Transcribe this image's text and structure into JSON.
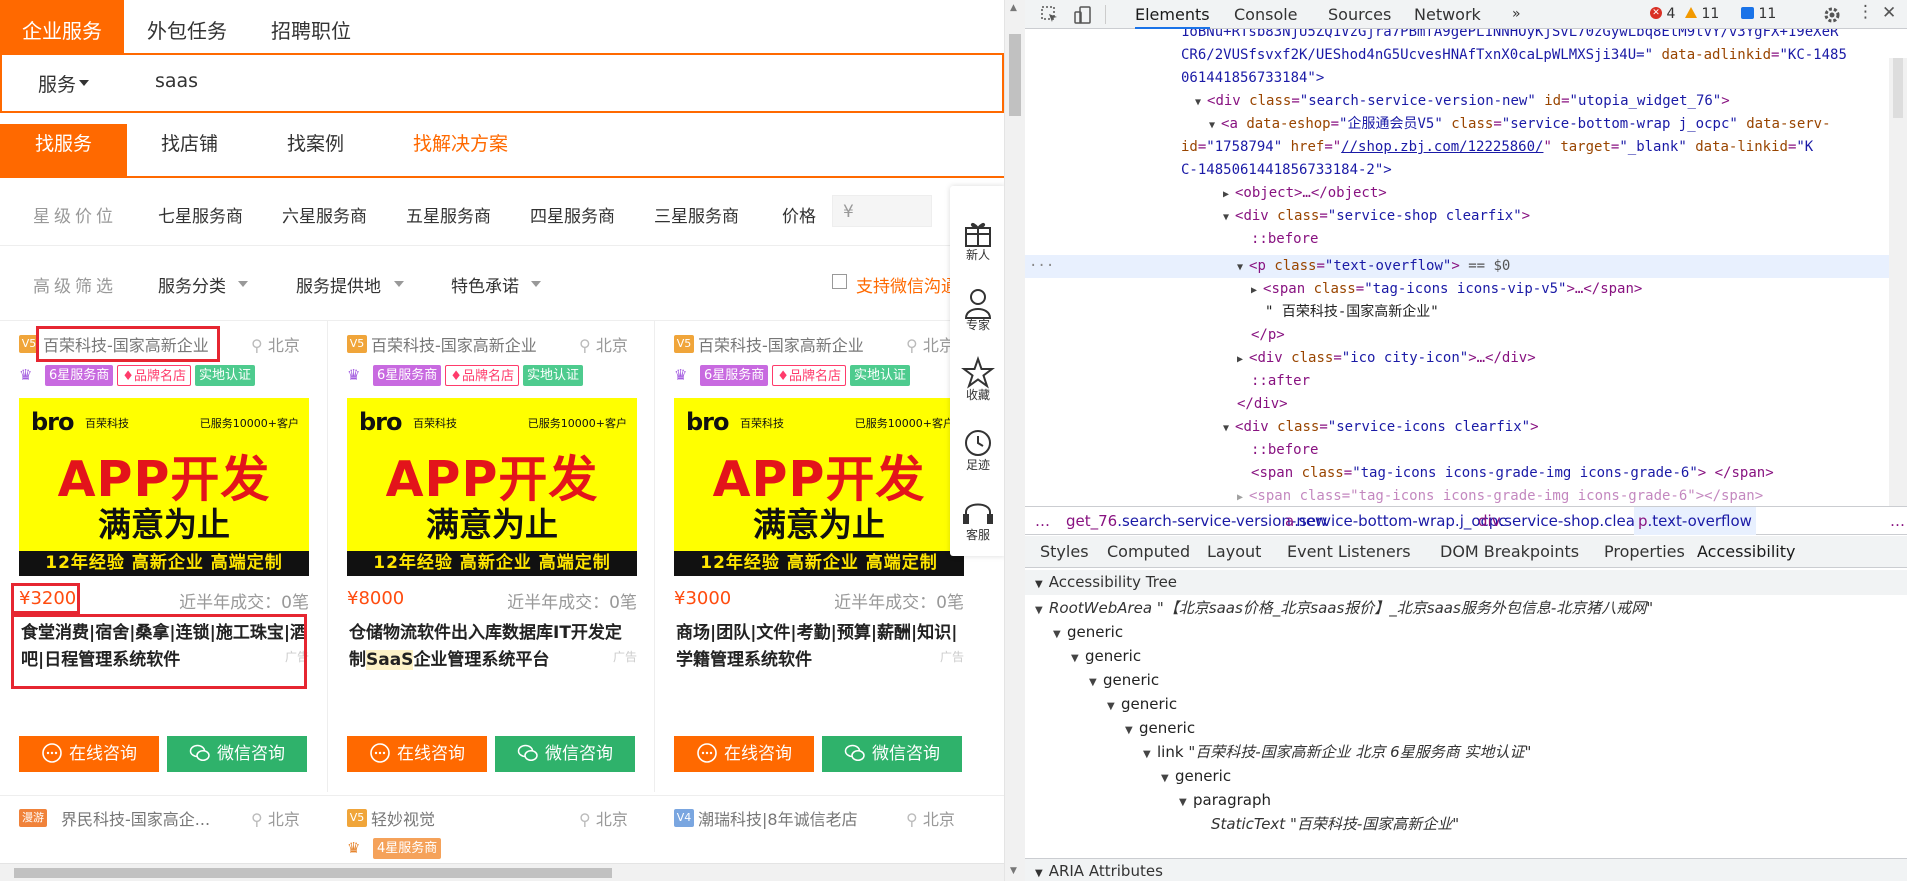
{
  "site": {
    "top_tabs": [
      "企业服务",
      "外包任务",
      "招聘职位"
    ],
    "search": {
      "category": "服务",
      "query": "saas"
    },
    "sub_tabs": [
      "找服务",
      "找店铺",
      "找案例",
      "找解决方案"
    ],
    "star_filter": {
      "label": "星级价位",
      "options": [
        "七星服务商",
        "六星服务商",
        "五星服务商",
        "四星服务商",
        "三星服务商"
      ],
      "price_label": "价格",
      "price_placeholder": "¥"
    },
    "adv_filter": {
      "label": "高级筛选",
      "dropdowns": [
        "服务分类",
        "服务提供地",
        "特色承诺"
      ],
      "checkbox_label": "支持微信沟通"
    },
    "side_float": [
      "新人",
      "专家",
      "收藏",
      "足迹",
      "客服"
    ],
    "cards": [
      {
        "badge": "V5",
        "shop": "百荣科技-国家高新企业",
        "city": "北京",
        "tags": [
          "6星服务商",
          "品牌名店",
          "实地认证"
        ],
        "banner": {
          "brand": "bro",
          "brand_cn": "百荣科技",
          "served": "已服务10000+客户",
          "headline": "APP开发",
          "sub": "满意为止",
          "strip": "12年经验 高新企业 高端定制"
        },
        "price": "¥3200",
        "sold": "近半年成交：0笔",
        "title_parts": [
          "食堂消费|宿舍|桑拿|连锁|施工珠宝|酒吧|日程管理系统软件"
        ],
        "ad": "广告",
        "btn_online": "在线咨询",
        "btn_wx": "微信咨询"
      },
      {
        "badge": "V5",
        "shop": "百荣科技-国家高新企业",
        "city": "北京",
        "tags": [
          "6星服务商",
          "品牌名店",
          "实地认证"
        ],
        "banner": {
          "brand": "bro",
          "brand_cn": "百荣科技",
          "served": "已服务10000+客户",
          "headline": "APP开发",
          "sub": "满意为止",
          "strip": "12年经验 高新企业 高端定制"
        },
        "price": "¥8000",
        "sold": "近半年成交：0笔",
        "title_a": "仓储物流软件出入库数据库IT开发定制",
        "title_hl": "SaaS",
        "title_b": "企业管理系统平台",
        "ad": "广告",
        "btn_online": "在线咨询",
        "btn_wx": "微信咨询"
      },
      {
        "badge": "V5",
        "shop": "百荣科技-国家高新企业",
        "city": "北京",
        "tags": [
          "6星服务商",
          "品牌名店",
          "实地认证"
        ],
        "banner": {
          "brand": "bro",
          "brand_cn": "百荣科技",
          "served": "已服务10000+客户",
          "headline": "APP开发",
          "sub": "满意为止",
          "strip": "12年经验 高新企业 高端定制"
        },
        "price": "¥3000",
        "sold": "近半年成交：0笔",
        "title": "商场|团队|文件|考勤|预算|薪酬|知识|学籍管理系统软件",
        "ad": "广告",
        "btn_online": "在线咨询",
        "btn_wx": "微信咨询"
      }
    ],
    "next_cards": [
      {
        "badge": "漫游",
        "shop": "界民科技-国家高企...",
        "city": "北京"
      },
      {
        "badge": "V5",
        "shop": "轻妙视觉",
        "city": "北京",
        "tag": "4星服务商"
      },
      {
        "badge": "V4",
        "shop": "潮瑞科技|8年诚信老店",
        "city": "北京"
      }
    ]
  },
  "devtools": {
    "tabs": [
      "Elements",
      "Console",
      "Sources",
      "Network"
    ],
    "errors": "4",
    "warnings": "11",
    "messages": "11",
    "dom_lines": [
      {
        "text": "1oBNu+RTsb83NjU5ZQ1VzGjra7PBmfA9gePL1NNHOyKjSvL70zGywLbq8EtM9tvY/v3YgFX+19eXeR"
      },
      {
        "text_a": "CR6/2VUSfsvxf2K/UEShod4nG5UcvesHNAfTxnX0caLpWLMXSji34U=\"",
        "attr": "data-adlinkid",
        "val": "\"KC-1485"
      },
      {
        "text": "061441856733184\">"
      },
      {
        "tag": "div",
        "attr1": "class",
        "val1": "\"search-service-version-new\"",
        "attr2": "id",
        "val2": "\"utopia_widget_76\""
      },
      {
        "tag": "a",
        "attr1": "data-eshop",
        "val1": "\"企服通会员V5\"",
        "attr2": "class",
        "val2": "\"service-bottom-wrap j_ocpc\"",
        "attr3": "data-serv-"
      },
      {
        "text_a": "id",
        "val": "\"1758794\"",
        "attr2": "href",
        "link": "//shop.zbj.com/12225860/",
        "attr3": "target",
        "val3": "\"_blank\"",
        "attr4": "data-linkid",
        "val4": "\"K"
      },
      {
        "text": "C-1485061441856733184-2\">"
      },
      {
        "text": "<object>…</object>"
      },
      {
        "tag": "div",
        "attr1": "class",
        "val1": "\"service-shop clearfix\""
      },
      {
        "text": "::before"
      },
      {
        "tag": "p",
        "attr1": "class",
        "val1": "\"text-overflow\"",
        "eq": "== $0"
      },
      {
        "tag": "span",
        "attr1": "class",
        "val1": "\"tag-icons icons-vip-v5\""
      },
      {
        "text": "\" 百荣科技-国家高新企业\""
      },
      {
        "text": "</p>"
      },
      {
        "tag": "div",
        "attr1": "class",
        "val1": "\"ico city-icon\""
      },
      {
        "text": "::after"
      },
      {
        "text": "</div>"
      },
      {
        "tag": "div",
        "attr1": "class",
        "val1": "\"service-icons clearfix\""
      },
      {
        "text": "::before"
      },
      {
        "tag": "span",
        "attr1": "class",
        "val1": "\"tag-icons icons-grade-img icons-grade-6\""
      },
      {
        "text": "<span class=\"tag-icons icons-grade-img icons-grade-6\"></span>"
      }
    ],
    "breadcrumbs": [
      {
        "tag": "…",
        "cls": ""
      },
      {
        "tag": "get_76",
        "cls": ".search-service-version-new"
      },
      {
        "tag": "a",
        "cls": ".service-bottom-wrap.j_ocpc"
      },
      {
        "tag": "div",
        "cls": ".service-shop.clearfix"
      },
      {
        "tag": "p",
        "cls": ".text-overflow"
      },
      {
        "tag": "…",
        "cls": ""
      }
    ],
    "panel_tabs": [
      "Styles",
      "Computed",
      "Layout",
      "Event Listeners",
      "DOM Breakpoints",
      "Properties",
      "Accessibility"
    ],
    "accessibility": {
      "header": "Accessibility Tree",
      "root_role": "RootWebArea",
      "root_name": "\"【北京saas价格_北京saas报价】_北京saas服务外包信息-北京猪八戒网\"",
      "nodes": [
        "generic",
        "generic",
        "generic",
        "generic",
        "generic"
      ],
      "link_role": "link",
      "link_name": "\"百荣科技-国家高新企业 北京 6星服务商 实地认证\"",
      "g6": "generic",
      "para": "paragraph",
      "static_role": "StaticText",
      "static_name": "\"百荣科技-国家高新企业\"",
      "aria_header": "ARIA Attributes"
    }
  }
}
